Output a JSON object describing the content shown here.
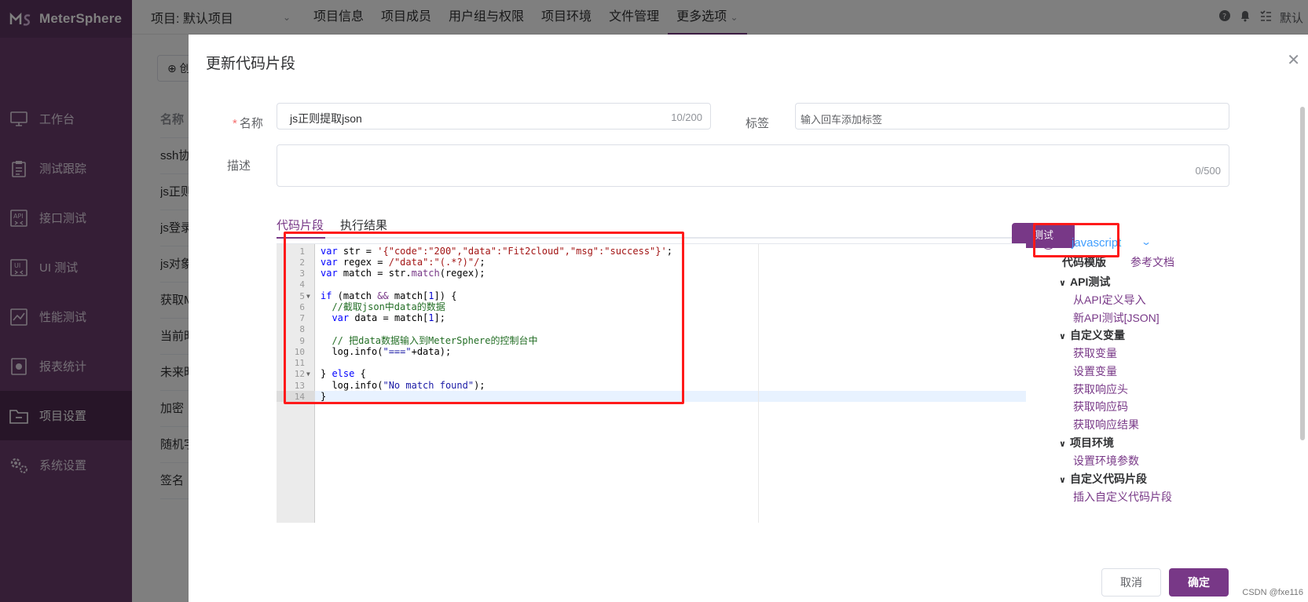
{
  "app": {
    "name": "MeterSphere"
  },
  "sidebar": {
    "items": [
      {
        "label": "工作台",
        "icon": "monitor-icon"
      },
      {
        "label": "测试跟踪",
        "icon": "clipboard-icon"
      },
      {
        "label": "接口测试",
        "icon": "api-icon"
      },
      {
        "label": "UI 测试",
        "icon": "ui-icon"
      },
      {
        "label": "性能测试",
        "icon": "chart-icon"
      },
      {
        "label": "报表统计",
        "icon": "report-icon"
      },
      {
        "label": "项目设置",
        "icon": "folder-icon"
      },
      {
        "label": "系统设置",
        "icon": "gears-icon"
      }
    ]
  },
  "header": {
    "project": "项目: 默认项目",
    "nav": [
      "项目信息",
      "项目成员",
      "用户组与权限",
      "项目环境",
      "文件管理",
      "更多选项"
    ],
    "right_text": "默认"
  },
  "background": {
    "add_label": "创",
    "column_header": "名称",
    "rows": [
      "ssh协",
      "js正则",
      "js登录",
      "js对象",
      "获取M",
      "当前时",
      "未来时",
      "加密",
      "随机字",
      "签名"
    ]
  },
  "dialog": {
    "title": "更新代码片段",
    "name_label": "名称",
    "name_value": "js正则提取json",
    "name_count": "10/200",
    "tag_label": "标签",
    "tag_placeholder": "输入回车添加标签",
    "desc_label": "描述",
    "desc_count": "0/500",
    "tabs": [
      "代码片段",
      "执行结果"
    ],
    "test_button": "测试",
    "cancel_button": "取消",
    "ok_button": "确定"
  },
  "code": {
    "line_numbers": [
      "1",
      "2",
      "3",
      "4",
      "5",
      "6",
      "7",
      "8",
      "9",
      "10",
      "11",
      "12",
      "13",
      "14"
    ]
  },
  "right_panel": {
    "language": "javascript",
    "template_title": "代码模版",
    "doc_link": "参考文档",
    "groups": [
      {
        "title": "API测试",
        "items": [
          "从API定义导入",
          "新API测试[JSON]"
        ]
      },
      {
        "title": "自定义变量",
        "items": [
          "获取变量",
          "设置变量",
          "获取响应头",
          "获取响应码",
          "获取响应结果"
        ]
      },
      {
        "title": "项目环境",
        "items": [
          "设置环境参数"
        ]
      },
      {
        "title": "自定义代码片段",
        "items": [
          "插入自定义代码片段"
        ]
      }
    ]
  },
  "watermark": "CSDN @fxe116",
  "colors": {
    "brand": "#783887",
    "sidebar": "#6b3d6d",
    "highlight_box": "#ff1a1a",
    "link_blue": "#409eff"
  }
}
